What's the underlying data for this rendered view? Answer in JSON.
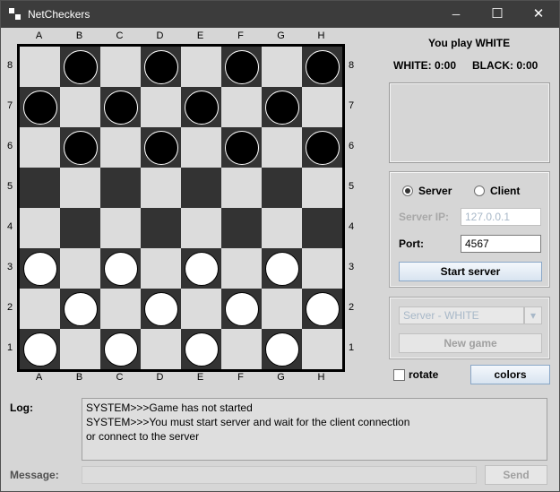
{
  "window": {
    "title": "NetCheckers",
    "minimize_glyph": "─",
    "maximize_glyph": "☐",
    "close_glyph": "✕"
  },
  "board": {
    "columns": [
      "A",
      "B",
      "C",
      "D",
      "E",
      "F",
      "G",
      "H"
    ],
    "rows": [
      "8",
      "7",
      "6",
      "5",
      "4",
      "3",
      "2",
      "1"
    ],
    "pieces": [
      {
        "row": "8",
        "col": "B",
        "color": "black"
      },
      {
        "row": "8",
        "col": "D",
        "color": "black"
      },
      {
        "row": "8",
        "col": "F",
        "color": "black"
      },
      {
        "row": "8",
        "col": "H",
        "color": "black"
      },
      {
        "row": "7",
        "col": "A",
        "color": "black"
      },
      {
        "row": "7",
        "col": "C",
        "color": "black"
      },
      {
        "row": "7",
        "col": "E",
        "color": "black"
      },
      {
        "row": "7",
        "col": "G",
        "color": "black"
      },
      {
        "row": "6",
        "col": "B",
        "color": "black"
      },
      {
        "row": "6",
        "col": "D",
        "color": "black"
      },
      {
        "row": "6",
        "col": "F",
        "color": "black"
      },
      {
        "row": "6",
        "col": "H",
        "color": "black"
      },
      {
        "row": "3",
        "col": "A",
        "color": "white"
      },
      {
        "row": "3",
        "col": "C",
        "color": "white"
      },
      {
        "row": "3",
        "col": "E",
        "color": "white"
      },
      {
        "row": "3",
        "col": "G",
        "color": "white"
      },
      {
        "row": "2",
        "col": "B",
        "color": "white"
      },
      {
        "row": "2",
        "col": "D",
        "color": "white"
      },
      {
        "row": "2",
        "col": "F",
        "color": "white"
      },
      {
        "row": "2",
        "col": "H",
        "color": "white"
      },
      {
        "row": "1",
        "col": "A",
        "color": "white"
      },
      {
        "row": "1",
        "col": "C",
        "color": "white"
      },
      {
        "row": "1",
        "col": "E",
        "color": "white"
      },
      {
        "row": "1",
        "col": "G",
        "color": "white"
      }
    ],
    "colors": {
      "light": "#dcdcdc",
      "dark": "#333333",
      "black_piece": "#000000",
      "white_piece": "#ffffff"
    }
  },
  "status": {
    "you_play": "You play WHITE",
    "white_score": "WHITE: 0:00",
    "black_score": "BLACK: 0:00"
  },
  "connection": {
    "server_label": "Server",
    "client_label": "Client",
    "selected": "server",
    "server_ip_label": "Server IP:",
    "server_ip_value": "127.0.0.1",
    "port_label": "Port:",
    "port_value": "4567",
    "start_label": "Start server"
  },
  "game": {
    "side_select": "Server - WHITE",
    "new_game_label": "New game",
    "rotate_label": "rotate",
    "colors_label": "colors"
  },
  "log": {
    "label": "Log:",
    "lines": [
      "SYSTEM>>>Game has not started",
      "SYSTEM>>>You must start server and wait for the client connection",
      "or connect to the server"
    ]
  },
  "message": {
    "label": "Message:",
    "value": "",
    "send_label": "Send"
  }
}
